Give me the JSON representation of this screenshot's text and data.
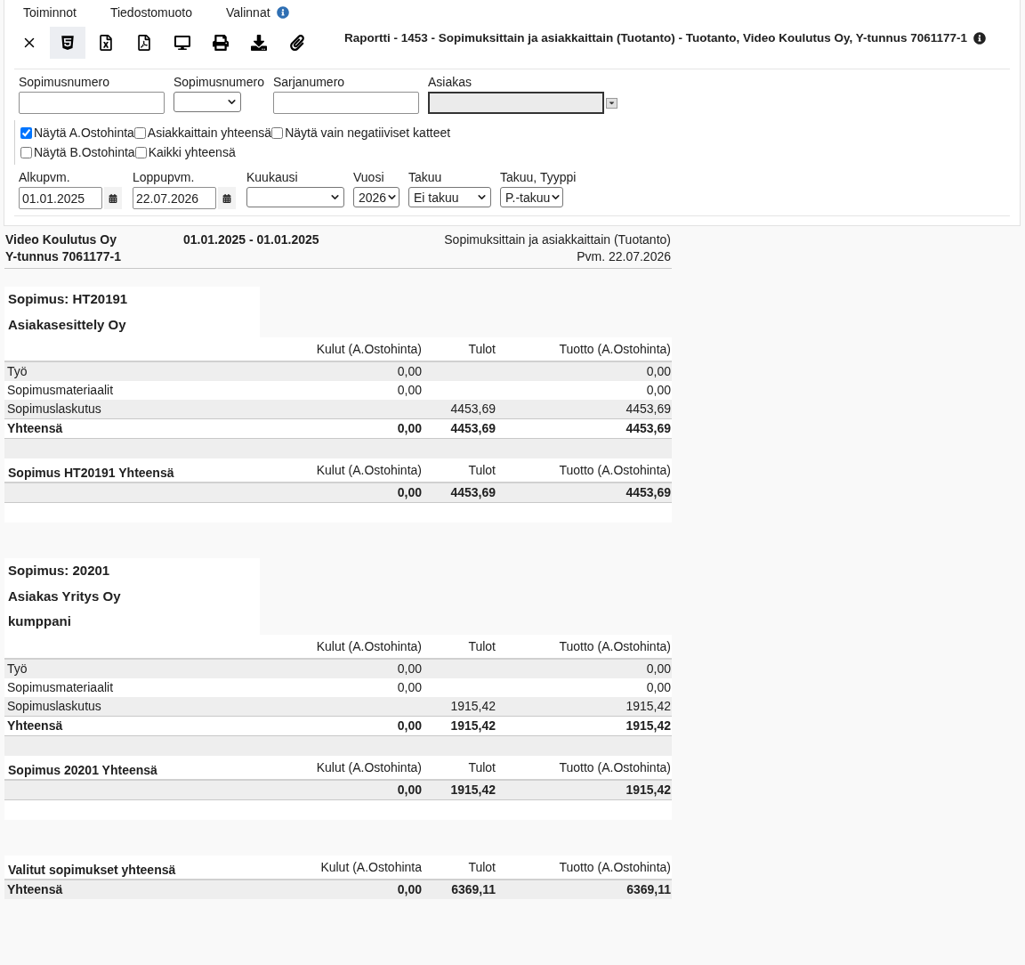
{
  "menu": [
    {
      "label": "Toiminnot"
    },
    {
      "label": "Tiedostomuoto"
    },
    {
      "label": "Valinnat",
      "info": true
    }
  ],
  "toolbar": [
    {
      "kind": "close",
      "selected": false
    },
    {
      "kind": "html",
      "selected": true
    },
    {
      "kind": "excel",
      "selected": false
    },
    {
      "kind": "pdf",
      "selected": false
    },
    {
      "kind": "screen",
      "selected": false
    },
    {
      "kind": "print",
      "selected": false
    },
    {
      "kind": "download",
      "selected": false
    },
    {
      "kind": "attach",
      "selected": false
    }
  ],
  "title": "Raportti - 1453 - Sopimuksittain ja asiakkaittain (Tuotanto) - Tuotanto, Video Koulutus Oy, Y-tunnus 7061177-1",
  "filters": [
    {
      "kind": "text",
      "label": "Sopimusnumero",
      "disabled": false
    },
    {
      "kind": "select",
      "label": "Sopimusnumero",
      "disabled": false
    },
    {
      "kind": "text",
      "label": "Sarjanumero",
      "disabled": false
    },
    {
      "kind": "combo",
      "label": "Asiakas",
      "disabled": true
    }
  ],
  "checkboxes": [
    [
      {
        "label": "Näytä A.Ostohinta",
        "checked": true
      },
      {
        "label": "Asiakkaittain yhteensä",
        "checked": false
      },
      {
        "label": "Näytä vain negatiiviset katteet",
        "checked": false
      }
    ],
    [
      {
        "label": "Näytä B.Ostohinta",
        "checked": false
      },
      {
        "label": "Kaikki yhteensä",
        "checked": false
      }
    ]
  ],
  "date_filters": [
    {
      "kind": "date",
      "label": "Alkupvm.",
      "value": "01.01.2025"
    },
    {
      "kind": "date",
      "label": "Loppupvm.",
      "value": "22.07.2026"
    },
    {
      "kind": "select",
      "label": "Kuukausi"
    },
    {
      "kind": "select",
      "label": "Vuosi",
      "value": "2026"
    },
    {
      "kind": "select",
      "label": "Takuu",
      "value": "Ei takuu"
    },
    {
      "kind": "select",
      "label": "Takuu, Tyyppi",
      "value": "P.-takuu"
    }
  ],
  "report_header": {
    "company": "Video Koulutus Oy",
    "period": "01.01.2025 - 01.01.2025",
    "report_name": "Sopimuksittain ja asiakkaittain (Tuotanto)",
    "business_id": "Y-tunnus 7061177-1",
    "date": "Pvm. 22.07.2026"
  },
  "sections": [
    {
      "heading": [
        "Sopimus: HT20191",
        "Asiakasesittely Oy"
      ],
      "columns": {
        "kulut": "Kulut (A.Ostohinta)",
        "tulot": "Tulot",
        "tuotto": "Tuotto (A.Ostohinta)"
      },
      "rows": [
        {
          "label": "Työ",
          "kulut": "0,00",
          "tuotto": "0,00"
        },
        {
          "label": "Sopimusmateriaalit",
          "kulut": "0,00",
          "tuotto": "0,00"
        },
        {
          "label": "Sopimuslaskutus",
          "tulot": "4453,69",
          "tuotto": "4453,69"
        }
      ],
      "total": {
        "label": "Yhteensä",
        "kulut": "0,00",
        "tulot": "4453,69",
        "tuotto": "4453,69"
      },
      "summary": {
        "title": "Sopimus HT20191 Yhteensä",
        "columns": {
          "kulut": "Kulut (A.Ostohinta)",
          "tulot": "Tulot",
          "tuotto": "Tuotto (A.Ostohinta)"
        },
        "kulut": "0,00",
        "tulot": "4453,69",
        "tuotto": "4453,69"
      }
    },
    {
      "heading": [
        "Sopimus: 20201",
        "Asiakas Yritys Oy",
        "kumppani"
      ],
      "columns": {
        "kulut": "Kulut (A.Ostohinta)",
        "tulot": "Tulot",
        "tuotto": "Tuotto (A.Ostohinta)"
      },
      "rows": [
        {
          "label": "Työ",
          "kulut": "0,00",
          "tuotto": "0,00"
        },
        {
          "label": "Sopimusmateriaalit",
          "kulut": "0,00",
          "tuotto": "0,00"
        },
        {
          "label": "Sopimuslaskutus",
          "tulot": "1915,42",
          "tuotto": "1915,42"
        }
      ],
      "total": {
        "label": "Yhteensä",
        "kulut": "0,00",
        "tulot": "1915,42",
        "tuotto": "1915,42"
      },
      "summary": {
        "title": "Sopimus 20201 Yhteensä",
        "columns": {
          "kulut": "Kulut (A.Ostohinta)",
          "tulot": "Tulot",
          "tuotto": "Tuotto (A.Ostohinta)"
        },
        "kulut": "0,00",
        "tulot": "1915,42",
        "tuotto": "1915,42"
      }
    }
  ],
  "grand_total": {
    "title": "Valitut sopimukset yhteensä",
    "columns": {
      "kulut": "Kulut (A.Ostohinta",
      "tulot": "Tulot",
      "tuotto": "Tuotto (A.Ostohinta)"
    },
    "label": "Yhteensä",
    "kulut": "0,00",
    "tulot": "6369,11",
    "tuotto": "6369,11"
  }
}
